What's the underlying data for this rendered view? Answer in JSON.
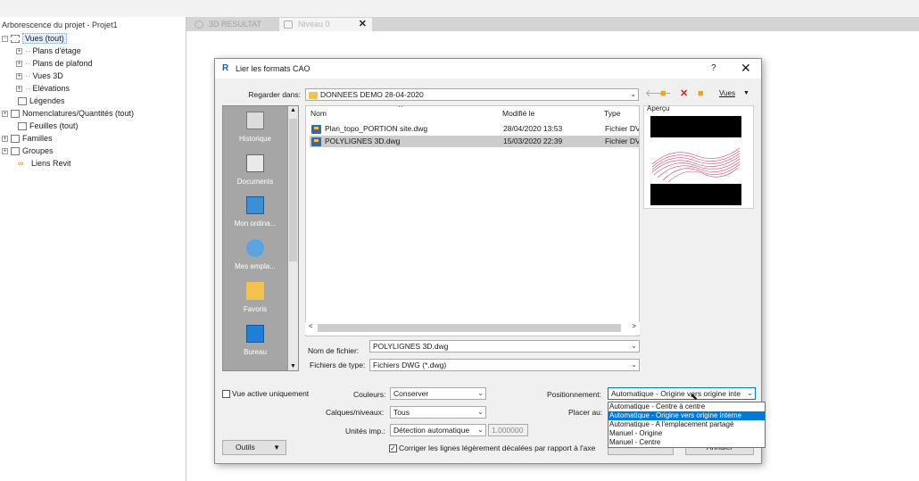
{
  "project_browser": {
    "title": "Arborescence du projet - Projet1",
    "nodes": [
      {
        "label": "Vues (tout)",
        "exp": "-",
        "icon": "views-icon"
      },
      {
        "label": "Plans d'étage",
        "exp": "+"
      },
      {
        "label": "Plans de plafond",
        "exp": "+"
      },
      {
        "label": "Vues 3D",
        "exp": "+"
      },
      {
        "label": "Elévations",
        "exp": "+"
      },
      {
        "label": "Légendes",
        "icon": "legend-icon"
      },
      {
        "label": "Nomenclatures/Quantités (tout)",
        "exp": "+",
        "icon": "schedule-icon"
      },
      {
        "label": "Feuilles (tout)",
        "icon": "sheet-icon"
      },
      {
        "label": "Familles",
        "exp": "+",
        "icon": "family-icon"
      },
      {
        "label": "Groupes",
        "exp": "+",
        "icon": "group-icon"
      },
      {
        "label": "Liens Revit",
        "icon": "revit-link-icon"
      }
    ]
  },
  "tabs": [
    {
      "label": "3D RESULTAT",
      "icon": "3d-view-icon"
    },
    {
      "label": "Niveau 0",
      "icon": "plan-view-icon",
      "close": "✕"
    }
  ],
  "dialog": {
    "title": "Lier les formats CAO",
    "help": "?",
    "close": "✕",
    "look_in_label": "Regarder dans:",
    "look_in_value": "DONNEES DEMO 28-04-2020",
    "views_label": "Vues",
    "preview_label": "Aperçu",
    "places": [
      "Historique",
      "Documents",
      "Mon ordina...",
      "Mes empla...",
      "Favoris",
      "Bureau"
    ],
    "columns": {
      "name": "Nom",
      "modified": "Modifié le",
      "type": "Type"
    },
    "files": [
      {
        "name": "Plan_topo_PORTION site.dwg",
        "modified": "28/04/2020 13:53",
        "type": "Fichier DV"
      },
      {
        "name": "POLYLIGNES 3D.dwg",
        "modified": "15/03/2020 22:39",
        "type": "Fichier DV"
      }
    ],
    "filename_label": "Nom de fichier:",
    "filename_value": "POLYLIGNES 3D.dwg",
    "filetype_label": "Fichiers de type:",
    "filetype_value": "Fichiers DWG  (*.dwg)",
    "current_view_only": "Vue active uniquement",
    "colors_label": "Couleurs:",
    "colors_value": "Conserver",
    "layers_label": "Calques/niveaux:",
    "layers_value": "Tous",
    "units_label": "Unités imp.:",
    "units_value": "Détection automatique",
    "units_factor": "1.000000",
    "correct_lines": "Corriger les lignes légèrement décalées par rapport à l'axe",
    "correct_lines_checked": "✓",
    "positioning_label": "Positionnement:",
    "positioning_value": "Automatique - Origine vers origine inte",
    "place_at_label": "Placer au:",
    "positioning_options": [
      "Automatique - Centre à centre",
      "Automatique - Origine vers origine interne",
      "Automatique - A l'emplacement partagé",
      "Manuel - Origine",
      "Manuel - Centre"
    ],
    "tools_label": "Outils",
    "cancel_label": "Annuler"
  },
  "colors": {
    "accent": "#0078d7",
    "selected_row": "#cccccc",
    "places_bg": "#a6a6a6"
  }
}
